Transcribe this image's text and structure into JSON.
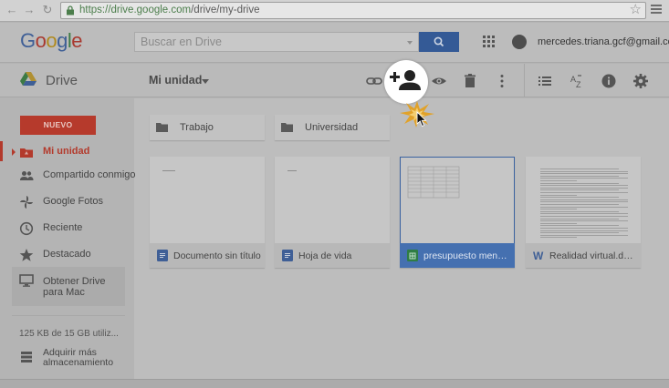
{
  "browser": {
    "url_secure": "https://",
    "url_host": "drive.google.com",
    "url_path": "/drive/my-drive"
  },
  "header": {
    "logo": "Google",
    "search_placeholder": "Buscar en Drive",
    "account_email": "mercedes.triana.gcf@gmail.com"
  },
  "toolbar": {
    "app_name": "Drive",
    "breadcrumb": "Mi unidad"
  },
  "sidebar": {
    "new_button": "NUEVO",
    "items": [
      {
        "label": "Mi unidad",
        "icon": "drive-folder-icon",
        "active": true
      },
      {
        "label": "Compartido conmigo",
        "icon": "people-icon"
      },
      {
        "label": "Google Fotos",
        "icon": "pinwheel-icon"
      },
      {
        "label": "Reciente",
        "icon": "clock-icon"
      },
      {
        "label": "Destacado",
        "icon": "star-icon"
      }
    ],
    "promo": "Obtener Drive para Mac",
    "quota": "125 KB de 15 GB utiliz...",
    "buy_storage": "Adquirir más almacenamiento"
  },
  "folders": [
    {
      "name": "Trabajo"
    },
    {
      "name": "Universidad"
    }
  ],
  "files": [
    {
      "name": "Documento sin título",
      "type": "doc"
    },
    {
      "name": "Hoja de vida",
      "type": "doc"
    },
    {
      "name": "presupuesto mensu...",
      "type": "sheet",
      "selected": true
    },
    {
      "name": "Realidad virtual.docx",
      "type": "word"
    }
  ],
  "colors": {
    "accent_red": "#b63a2c",
    "selection_blue": "#3a62a0",
    "search_blue": "#345a96"
  }
}
